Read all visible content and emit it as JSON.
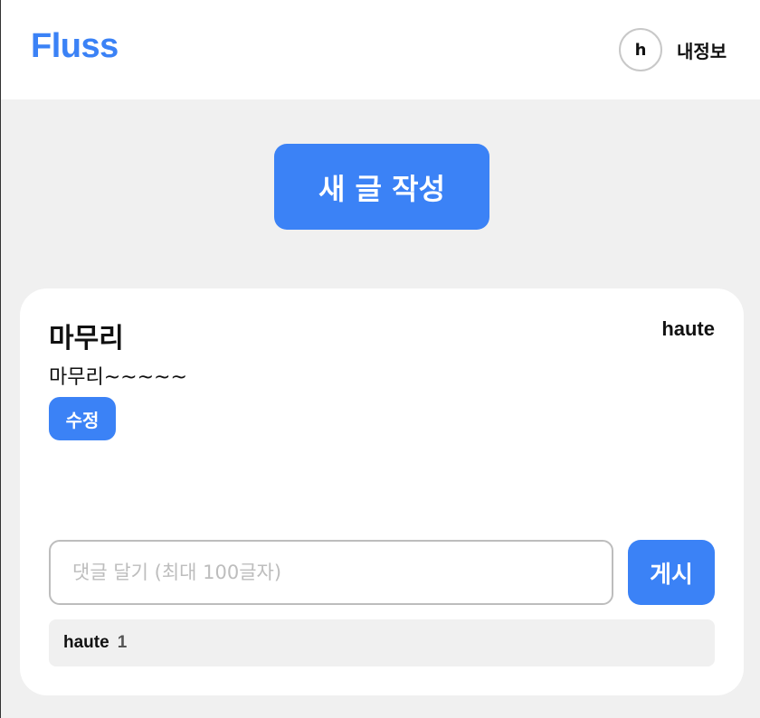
{
  "header": {
    "logo": "Fluss",
    "avatar_initial": "h",
    "my_info_label": "내정보"
  },
  "actions": {
    "new_post_label": "새 글 작성"
  },
  "post": {
    "title": "마무리",
    "author": "haute",
    "content": "마무리~~~~~",
    "edit_label": "수정",
    "comment_input": {
      "value": "",
      "placeholder": "댓글 달기 (최대 100글자)"
    },
    "post_comment_label": "게시",
    "comments": [
      {
        "author": "haute",
        "text": "1"
      }
    ]
  },
  "colors": {
    "accent": "#3b82f6",
    "background": "#f0f0f0",
    "card": "#ffffff"
  }
}
